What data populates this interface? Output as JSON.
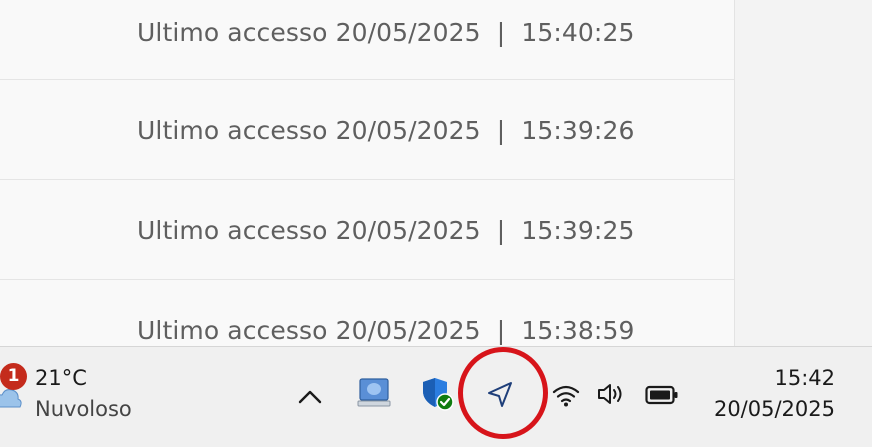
{
  "list": {
    "rows": [
      {
        "text": "Ultimo accesso 20/05/2025  |  15:40:25"
      },
      {
        "text": "Ultimo accesso 20/05/2025  |  15:39:26"
      },
      {
        "text": "Ultimo accesso 20/05/2025  |  15:39:25"
      },
      {
        "text": "Ultimo accesso 20/05/2025  |  15:38:59"
      }
    ]
  },
  "taskbar": {
    "weather": {
      "badge_count": "1",
      "temperature": "21°C",
      "condition": "Nuvoloso",
      "icon": "cloud-icon"
    },
    "tray_icons": [
      "chevron-up-icon",
      "network-computer-icon",
      "windows-security-icon",
      "location-icon",
      "wifi-icon",
      "volume-icon",
      "battery-icon"
    ],
    "highlight_color": "#d7141a",
    "clock": {
      "time": "15:42",
      "date": "20/05/2025"
    }
  }
}
